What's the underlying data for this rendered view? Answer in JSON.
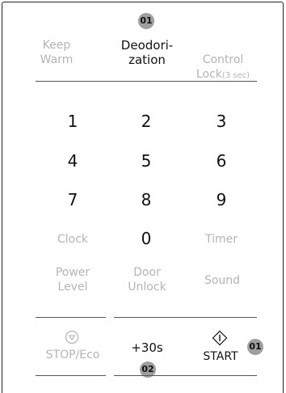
{
  "top_row": {
    "keep_warm": "Keep\nWarm",
    "deodorization": "Deodori-\nzation",
    "control_lock": "Control\nLock",
    "control_lock_sec": "(3 sec)"
  },
  "badges": {
    "top": "01",
    "start": "01",
    "plus30": "02"
  },
  "keypad": {
    "k1": "1",
    "k2": "2",
    "k3": "3",
    "k4": "4",
    "k5": "5",
    "k6": "6",
    "k7": "7",
    "k8": "8",
    "k9": "9",
    "k0": "0"
  },
  "side_keys": {
    "clock": "Clock",
    "timer": "Timer",
    "power_level": "Power\nLevel",
    "door_unlock": "Door\nUnlock",
    "sound": "Sound"
  },
  "bottom_row": {
    "stop_eco": "STOP/Eco",
    "plus30": "+30s",
    "start": "START"
  },
  "icons": {
    "stop": "stop-triangle-icon",
    "start": "start-diamond-icon"
  }
}
